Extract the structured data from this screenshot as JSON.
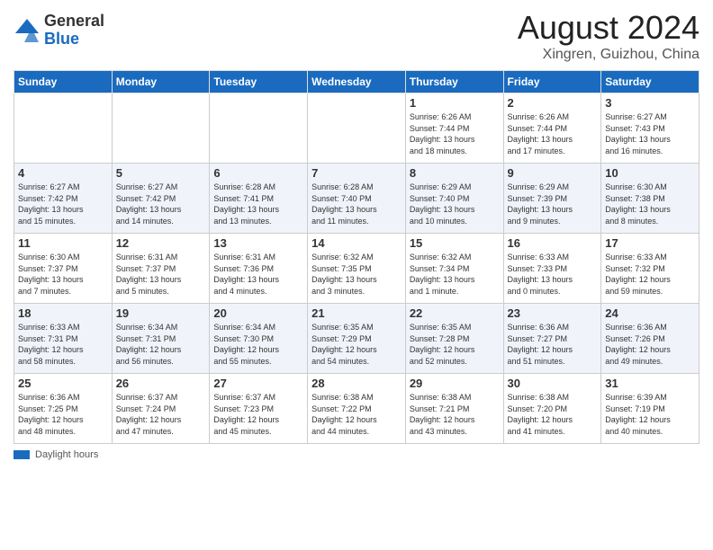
{
  "logo": {
    "general": "General",
    "blue": "Blue"
  },
  "title": "August 2024",
  "subtitle": "Xingren, Guizhou, China",
  "weekdays": [
    "Sunday",
    "Monday",
    "Tuesday",
    "Wednesday",
    "Thursday",
    "Friday",
    "Saturday"
  ],
  "weeks": [
    [
      {
        "day": "",
        "info": ""
      },
      {
        "day": "",
        "info": ""
      },
      {
        "day": "",
        "info": ""
      },
      {
        "day": "",
        "info": ""
      },
      {
        "day": "1",
        "info": "Sunrise: 6:26 AM\nSunset: 7:44 PM\nDaylight: 13 hours\nand 18 minutes."
      },
      {
        "day": "2",
        "info": "Sunrise: 6:26 AM\nSunset: 7:44 PM\nDaylight: 13 hours\nand 17 minutes."
      },
      {
        "day": "3",
        "info": "Sunrise: 6:27 AM\nSunset: 7:43 PM\nDaylight: 13 hours\nand 16 minutes."
      }
    ],
    [
      {
        "day": "4",
        "info": "Sunrise: 6:27 AM\nSunset: 7:42 PM\nDaylight: 13 hours\nand 15 minutes."
      },
      {
        "day": "5",
        "info": "Sunrise: 6:27 AM\nSunset: 7:42 PM\nDaylight: 13 hours\nand 14 minutes."
      },
      {
        "day": "6",
        "info": "Sunrise: 6:28 AM\nSunset: 7:41 PM\nDaylight: 13 hours\nand 13 minutes."
      },
      {
        "day": "7",
        "info": "Sunrise: 6:28 AM\nSunset: 7:40 PM\nDaylight: 13 hours\nand 11 minutes."
      },
      {
        "day": "8",
        "info": "Sunrise: 6:29 AM\nSunset: 7:40 PM\nDaylight: 13 hours\nand 10 minutes."
      },
      {
        "day": "9",
        "info": "Sunrise: 6:29 AM\nSunset: 7:39 PM\nDaylight: 13 hours\nand 9 minutes."
      },
      {
        "day": "10",
        "info": "Sunrise: 6:30 AM\nSunset: 7:38 PM\nDaylight: 13 hours\nand 8 minutes."
      }
    ],
    [
      {
        "day": "11",
        "info": "Sunrise: 6:30 AM\nSunset: 7:37 PM\nDaylight: 13 hours\nand 7 minutes."
      },
      {
        "day": "12",
        "info": "Sunrise: 6:31 AM\nSunset: 7:37 PM\nDaylight: 13 hours\nand 5 minutes."
      },
      {
        "day": "13",
        "info": "Sunrise: 6:31 AM\nSunset: 7:36 PM\nDaylight: 13 hours\nand 4 minutes."
      },
      {
        "day": "14",
        "info": "Sunrise: 6:32 AM\nSunset: 7:35 PM\nDaylight: 13 hours\nand 3 minutes."
      },
      {
        "day": "15",
        "info": "Sunrise: 6:32 AM\nSunset: 7:34 PM\nDaylight: 13 hours\nand 1 minute."
      },
      {
        "day": "16",
        "info": "Sunrise: 6:33 AM\nSunset: 7:33 PM\nDaylight: 13 hours\nand 0 minutes."
      },
      {
        "day": "17",
        "info": "Sunrise: 6:33 AM\nSunset: 7:32 PM\nDaylight: 12 hours\nand 59 minutes."
      }
    ],
    [
      {
        "day": "18",
        "info": "Sunrise: 6:33 AM\nSunset: 7:31 PM\nDaylight: 12 hours\nand 58 minutes."
      },
      {
        "day": "19",
        "info": "Sunrise: 6:34 AM\nSunset: 7:31 PM\nDaylight: 12 hours\nand 56 minutes."
      },
      {
        "day": "20",
        "info": "Sunrise: 6:34 AM\nSunset: 7:30 PM\nDaylight: 12 hours\nand 55 minutes."
      },
      {
        "day": "21",
        "info": "Sunrise: 6:35 AM\nSunset: 7:29 PM\nDaylight: 12 hours\nand 54 minutes."
      },
      {
        "day": "22",
        "info": "Sunrise: 6:35 AM\nSunset: 7:28 PM\nDaylight: 12 hours\nand 52 minutes."
      },
      {
        "day": "23",
        "info": "Sunrise: 6:36 AM\nSunset: 7:27 PM\nDaylight: 12 hours\nand 51 minutes."
      },
      {
        "day": "24",
        "info": "Sunrise: 6:36 AM\nSunset: 7:26 PM\nDaylight: 12 hours\nand 49 minutes."
      }
    ],
    [
      {
        "day": "25",
        "info": "Sunrise: 6:36 AM\nSunset: 7:25 PM\nDaylight: 12 hours\nand 48 minutes."
      },
      {
        "day": "26",
        "info": "Sunrise: 6:37 AM\nSunset: 7:24 PM\nDaylight: 12 hours\nand 47 minutes."
      },
      {
        "day": "27",
        "info": "Sunrise: 6:37 AM\nSunset: 7:23 PM\nDaylight: 12 hours\nand 45 minutes."
      },
      {
        "day": "28",
        "info": "Sunrise: 6:38 AM\nSunset: 7:22 PM\nDaylight: 12 hours\nand 44 minutes."
      },
      {
        "day": "29",
        "info": "Sunrise: 6:38 AM\nSunset: 7:21 PM\nDaylight: 12 hours\nand 43 minutes."
      },
      {
        "day": "30",
        "info": "Sunrise: 6:38 AM\nSunset: 7:20 PM\nDaylight: 12 hours\nand 41 minutes."
      },
      {
        "day": "31",
        "info": "Sunrise: 6:39 AM\nSunset: 7:19 PM\nDaylight: 12 hours\nand 40 minutes."
      }
    ]
  ],
  "legend_daylight": "Daylight hours"
}
